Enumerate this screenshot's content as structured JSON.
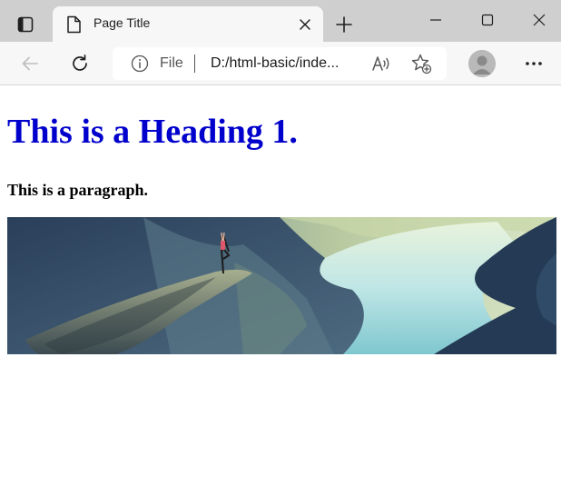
{
  "browser": {
    "tab": {
      "title": "Page Title"
    },
    "address_bar": {
      "scheme_label": "File",
      "url": "D:/html-basic/inde..."
    }
  },
  "colors": {
    "heading": "#0000cc",
    "paragraph": "#000000",
    "tabstrip": "#cfcfcf",
    "toolbar": "#f7f7f7"
  },
  "icons": {
    "tab_actions": "tab-actions-icon",
    "favicon": "document-icon",
    "tab_close": "close-icon",
    "new_tab": "plus-icon",
    "minimize": "minimize-icon",
    "maximize": "maximize-icon",
    "close_window": "close-icon",
    "back": "back-arrow-icon",
    "reload": "reload-icon",
    "site_info": "info-icon",
    "read_aloud": "read-aloud-icon",
    "add_favorite": "add-favorite-icon",
    "profile": "profile-avatar-icon",
    "more": "more-options-icon"
  },
  "content": {
    "heading": "This is a Heading 1.",
    "paragraph": "This is a paragraph."
  }
}
